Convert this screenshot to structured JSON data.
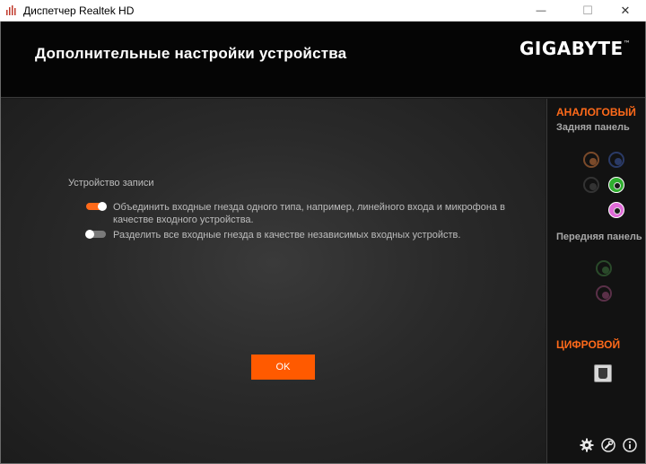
{
  "window": {
    "title": "Диспетчер Realtek HD",
    "minimize_glyph": "—",
    "maximize_glyph": "☐",
    "close_glyph": "✕"
  },
  "header": {
    "title": "Дополнительные настройки устройства",
    "brand": "GIGABYTE",
    "brand_mark": "™"
  },
  "main": {
    "section_label": "Устройство записи",
    "options": [
      {
        "label": "Объединить входные гнезда одного типа, например, линейного входа и микрофона в качестве входного устройства.",
        "state": "on"
      },
      {
        "label": "Разделить все входные гнезда в качестве независимых входных устройств.",
        "state": "off"
      }
    ],
    "ok_label": "OK"
  },
  "sidebar": {
    "analog_heading": "АНАЛОГОВЫЙ",
    "rear_label": "Задняя панель",
    "front_label": "Передняя панель",
    "digital_heading": "ЦИФРОВОЙ",
    "rear_jacks": [
      {
        "name": "rear-orange-jack",
        "color": "#7a4a2a",
        "active": false
      },
      {
        "name": "rear-blue-jack",
        "color": "#2a3a66",
        "active": false
      },
      {
        "name": "rear-black-jack",
        "color": "#333333",
        "active": false
      },
      {
        "name": "rear-green-jack",
        "color": "#2fae2f",
        "active": true
      },
      {
        "name": "rear-pink-jack",
        "color": "#e06ad8",
        "active": true
      }
    ],
    "front_jacks": [
      {
        "name": "front-green-jack",
        "color": "#2a4a2a",
        "active": false
      },
      {
        "name": "front-pink-jack",
        "color": "#5a3048",
        "active": false
      }
    ],
    "footer_icons": [
      "gear-icon",
      "wrench-icon",
      "info-icon"
    ]
  },
  "colors": {
    "accent": "#ff5a00",
    "heading_accent": "#ff6a1a"
  }
}
